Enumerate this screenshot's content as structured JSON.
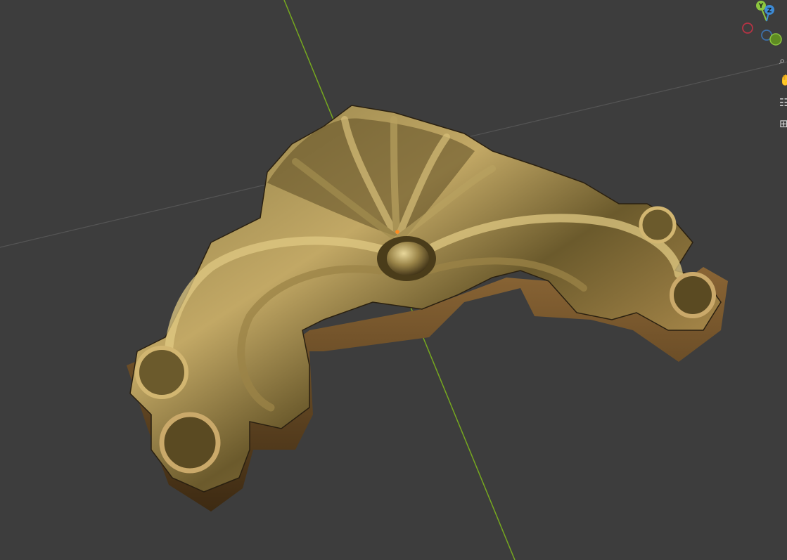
{
  "viewport": {
    "background": "#3d3d3d",
    "grid_line_color": "#525252",
    "y_axis_color": "#76a81f",
    "object": {
      "name": "ornament-shell-scroll-mesh",
      "material_color": "#7a6a38"
    },
    "origin_color": "#ff8a1f"
  },
  "gizmo": {
    "axes": [
      {
        "key": "y",
        "label": "Y",
        "color": "#8cc63f"
      },
      {
        "key": "z",
        "label": "Z",
        "color": "#3d8bd6"
      },
      {
        "key": "x_neg",
        "label": "",
        "color": "#b53344"
      },
      {
        "key": "z_neg",
        "label": "",
        "color": "#3d6fa8"
      },
      {
        "key": "y_neg",
        "label": "",
        "color": "#6a9a2a"
      }
    ]
  },
  "toolbar": {
    "items": [
      {
        "name": "zoom",
        "icon": "magnifier-icon",
        "glyph": "⌕"
      },
      {
        "name": "pan",
        "icon": "hand-icon",
        "glyph": "✋"
      },
      {
        "name": "camera",
        "icon": "camera-icon",
        "glyph": "☷"
      },
      {
        "name": "ortho",
        "icon": "grid-icon",
        "glyph": "⊞"
      }
    ]
  }
}
